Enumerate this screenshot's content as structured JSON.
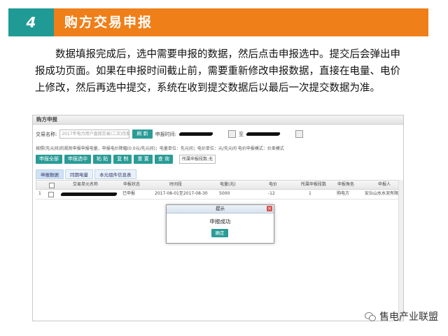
{
  "slide": {
    "number": "4",
    "title": "购方交易申报",
    "paragraph": "数据填报完成后，选中需要申报的数据，然后点击申报选中。提交后会弹出申报成功页面。如果在申报时间截止前，需要重新修改申报数据，直接在电量、电价上修改，然后再选中提交，系统在收到提交数据后以最后一次提交数据为准。"
  },
  "panel": {
    "title": "购方申报",
    "trade_label": "交易名称:",
    "trade_value": "2017年电力用户直接交易(二次)月度申报",
    "refresh_label": "刷 新",
    "time_label": "申报时间:",
    "to_label": "至",
    "hint": "按照(先元间)的规则申报申报电量，申报电价降幅(0.0元/先元间)；电量单位：先元间；电价单位：元/先元间 电价申报模式：价差模式",
    "toolbar": {
      "buttons": [
        "申报全部",
        "申报选中",
        "粘 贴",
        "复 制",
        "重 置",
        "查 询"
      ],
      "select": "所属申报段数:无"
    },
    "tabs": [
      "申报数据",
      "同期电量",
      "本元组件信息表"
    ],
    "columns": [
      "交易单元名称",
      "申报状态",
      "时间段",
      "电量(兆)",
      "电价",
      "所属申报段数",
      "申报角色",
      "申报人"
    ],
    "rows": [
      {
        "index": "1",
        "status": "已申报",
        "period": "2017-08-01至2017-08-30",
        "energy": "5000",
        "price": "-12",
        "segment": "1",
        "role": "购电方",
        "declarant": "安丘山水水泥有限公"
      }
    ]
  },
  "modal": {
    "title": "提示",
    "close": "×",
    "message": "申报成功",
    "ok": "确定"
  },
  "footer": {
    "brand": "售电产业联盟"
  }
}
